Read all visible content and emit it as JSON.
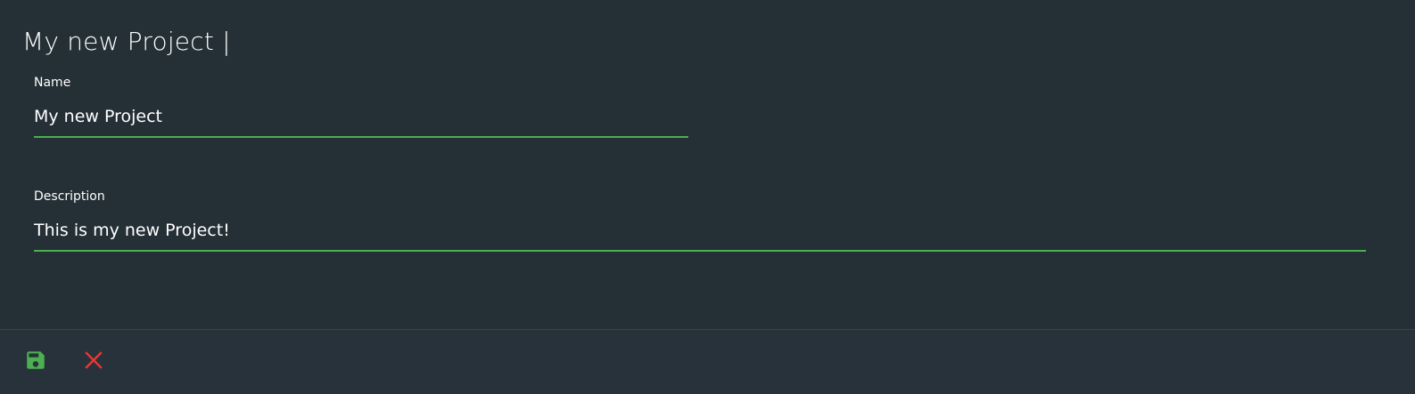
{
  "header": {
    "title": "My new Project |"
  },
  "form": {
    "name": {
      "label": "Name",
      "value": "My new Project"
    },
    "description": {
      "label": "Description",
      "value": "This is my new Project!"
    }
  },
  "toolbar": {
    "save_icon": "floppy-disk-icon",
    "cancel_icon": "close-icon"
  },
  "colors": {
    "background": "#242f36",
    "accent": "#4caf50",
    "danger": "#e53935"
  }
}
